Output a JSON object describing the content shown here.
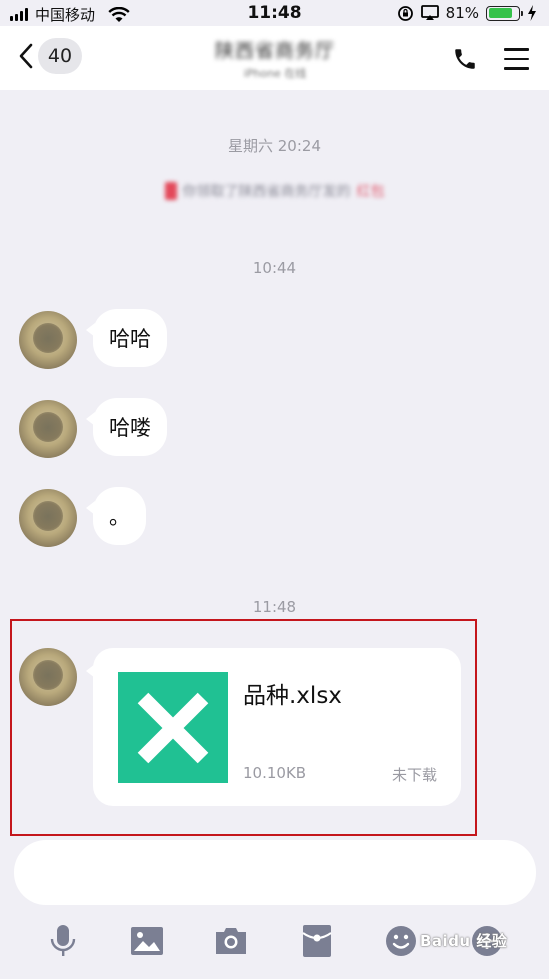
{
  "status_bar": {
    "carrier": "中国移动",
    "time": "11:48",
    "battery_percent": "81%",
    "battery_level": 0.81,
    "icons": [
      "signal-icon",
      "wifi-icon",
      "rotation-lock-icon",
      "airplay-icon",
      "battery-icon",
      "charging-icon"
    ]
  },
  "nav": {
    "back_count": "40",
    "title": "陕西省商务厅",
    "subtitle": "iPhone 在线",
    "icons": [
      "back-chevron-icon",
      "phone-icon",
      "menu-icon"
    ]
  },
  "chat": {
    "timestamps": [
      "星期六 20:24",
      "10:44",
      "11:48"
    ],
    "system_notice": {
      "text": "你领取了陕西省商务厅发的",
      "link": "红包"
    },
    "messages": [
      {
        "sender": "contact",
        "text": "哈哈"
      },
      {
        "sender": "contact",
        "text": "哈喽"
      },
      {
        "sender": "contact",
        "text": "。"
      }
    ],
    "file_message": {
      "file_name": "品种.xlsx",
      "file_size": "10.10KB",
      "status": "未下载",
      "icon": "excel-file-icon",
      "icon_color": "#20c193",
      "highlight_color": "#c4161c"
    }
  },
  "toolbar": {
    "icons": [
      "microphone-icon",
      "image-icon",
      "camera-icon",
      "red-packet-icon",
      "emoji-icon",
      "plus-icon"
    ]
  },
  "watermark": "Baidu 经验"
}
